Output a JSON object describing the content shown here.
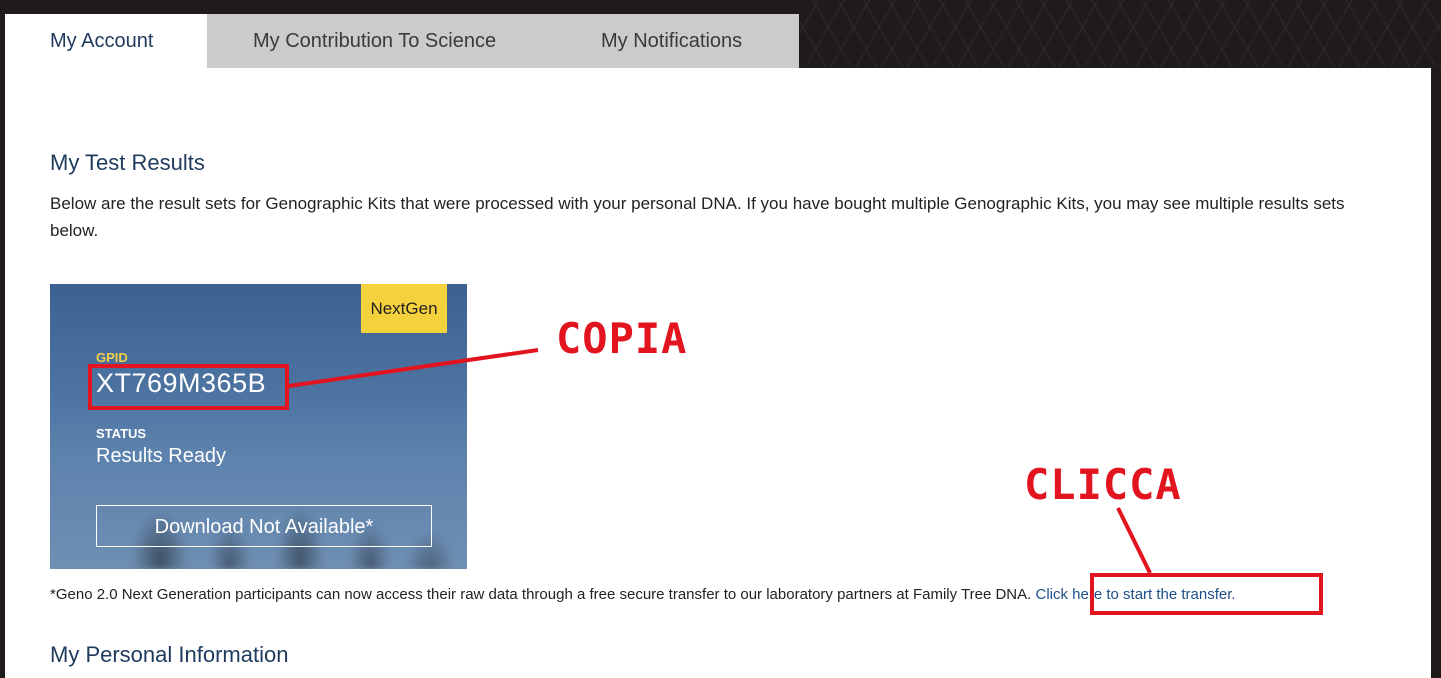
{
  "tabs": [
    {
      "label": "My Account",
      "active": true
    },
    {
      "label": "My Contribution To Science",
      "active": false
    },
    {
      "label": "My Notifications",
      "active": false
    }
  ],
  "results": {
    "heading": "My Test Results",
    "intro": "Below are the result sets for Genographic Kits that were processed with your personal DNA. If you have bought multiple Genographic Kits, you may see multiple results sets below."
  },
  "kit_card": {
    "badge": "NextGen",
    "gpid_label": "GPID",
    "gpid_value": "XT769M365B",
    "status_label": "STATUS",
    "status_value": "Results Ready",
    "download_label": "Download Not Available*"
  },
  "transfer_note": {
    "text": "*Geno 2.0 Next Generation participants can now access their raw data through a free secure transfer to our laboratory partners at Family Tree DNA.",
    "link": "Click here to start the transfer."
  },
  "personal_info": {
    "heading": "My Personal Information"
  },
  "annotations": {
    "copy_label": "COPIA",
    "click_label": "CLICCA",
    "color": "#e1141f"
  },
  "colors": {
    "heading": "#1e3a5c",
    "badge": "#f6d13e",
    "link": "#1e4f8a"
  }
}
